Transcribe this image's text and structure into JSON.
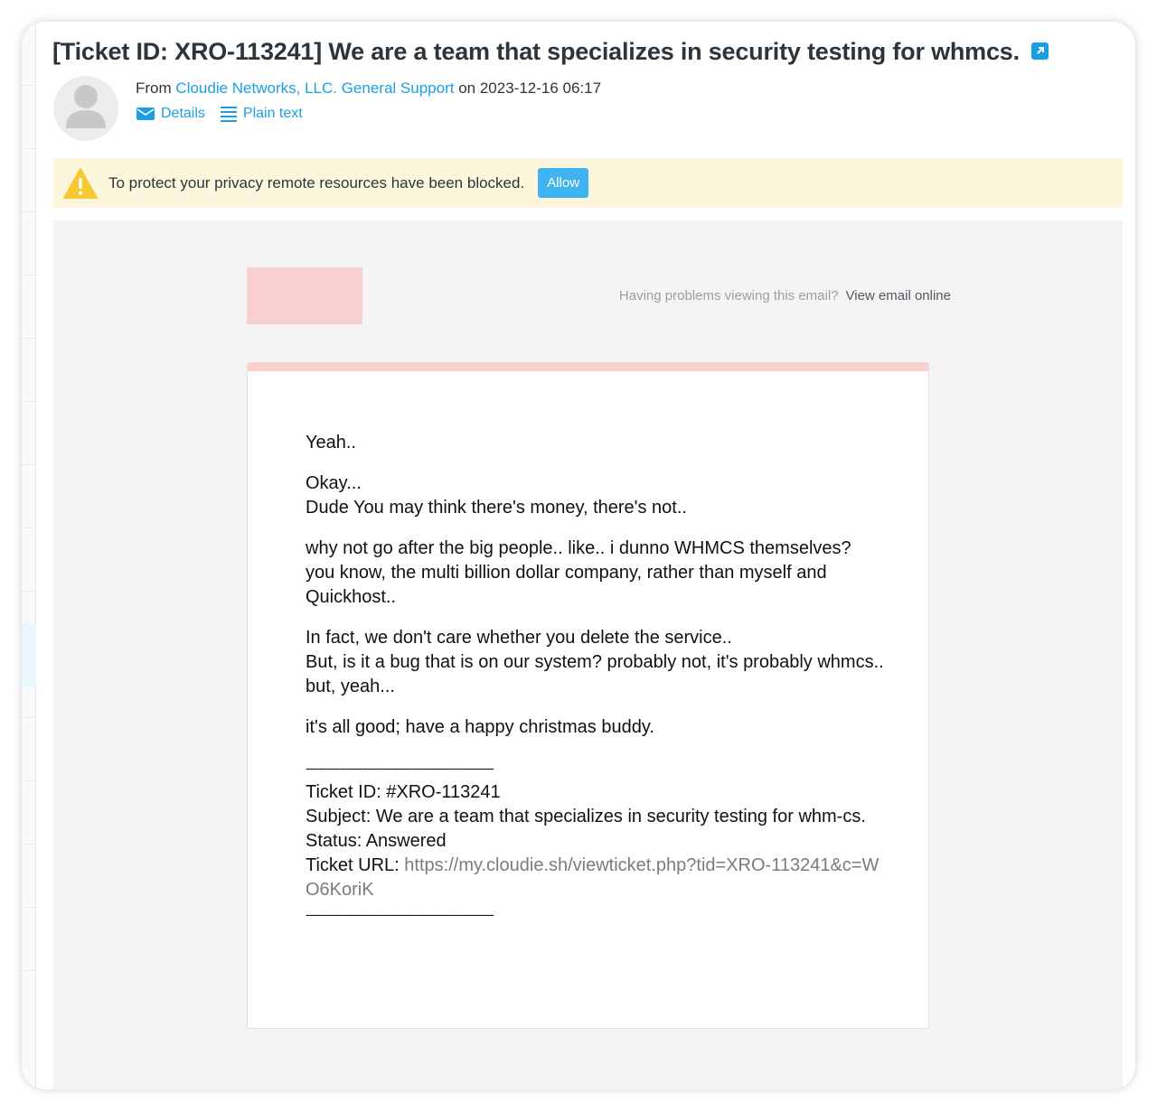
{
  "email": {
    "subject": "[Ticket ID: XRO-113241] We are a team that specializes in security testing for whmcs.",
    "from_prefix": "From",
    "sender": "Cloudie Networks, LLC. General Support",
    "date_prefix": "on",
    "date": "2023-12-16 06:17",
    "actions": {
      "details": "Details",
      "plain_text": "Plain text"
    }
  },
  "notice": {
    "message": "To protect your privacy remote resources have been blocked.",
    "allow": "Allow"
  },
  "preheader": {
    "question": "Having problems viewing this email?",
    "view_online": "View email online"
  },
  "body": {
    "p1": "Yeah..",
    "p2a": "Okay...",
    "p2b": "Dude You may think there's money, there's not..",
    "p3": "why not go after the big people.. like.. i dunno WHMCS themselves? you know, the multi billion dollar company, rather than myself and Quickhost..",
    "p4a": "In fact, we don't care whether you delete the service..",
    "p4b": "But, is it a bug that is on our system? probably not, it's probably whmcs..",
    "p4c": "but, yeah...",
    "p5": "it's all good; have a happy christmas buddy.",
    "divider": "------------------------------------------------------------",
    "ticket_id": "Ticket ID: #XRO-113241",
    "subject_line": "Subject: We are a team that specializes in security testing for whm-cs.",
    "status": "Status: Answered",
    "url_label": "Ticket URL:",
    "url": "https://my.cloudie.sh/viewticket.php?tid=XRO-113241&c=WO6KoriK"
  },
  "colors": {
    "link": "#1a9fe3",
    "notice_bg": "#fcf7dc",
    "allow_bg": "#3fb3f2",
    "brand_accent": "#f9cfcf"
  },
  "icons": [
    "external-link-icon",
    "avatar-icon",
    "envelope-icon",
    "list-icon",
    "warning-icon"
  ]
}
